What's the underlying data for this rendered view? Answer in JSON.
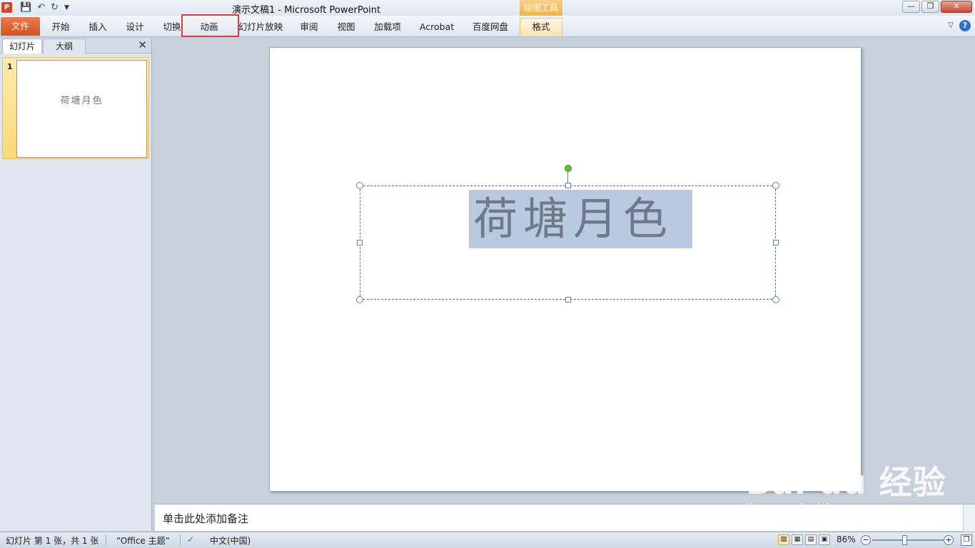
{
  "titlebar": {
    "app_icon": "P",
    "title": "演示文稿1  -  Microsoft PowerPoint",
    "contextual_tag": "绘图工具",
    "qat_icons": [
      "save-icon",
      "undo-icon",
      "redo-icon",
      "customize-icon"
    ]
  },
  "ribbon": {
    "tabs": [
      "文件",
      "开始",
      "插入",
      "设计",
      "切换",
      "动画",
      "幻灯片放映",
      "审阅",
      "视图",
      "加载项",
      "Acrobat",
      "百度网盘",
      "格式"
    ],
    "highlighted_tab": "动画"
  },
  "left_panel": {
    "tab_slides": "幻灯片",
    "tab_outline": "大纲",
    "slide_number": "1",
    "thumb_text": "荷塘月色"
  },
  "slide": {
    "title_text": "荷塘月色"
  },
  "notes": {
    "placeholder": "单击此处添加备注"
  },
  "statusbar": {
    "slide_info": "幻灯片 第 1 张，共 1 张",
    "theme": "“Office 主题”",
    "language": "中文(中国)",
    "zoom": "86%"
  },
  "watermark": {
    "main": "Bai du 经验",
    "sub": "jingyan.baidu.com"
  },
  "colors": {
    "file_tab": "#d3521f",
    "highlight_box": "#e03a3a",
    "selection": "#b9c9e0",
    "drawing_tools": "#f0b447"
  }
}
